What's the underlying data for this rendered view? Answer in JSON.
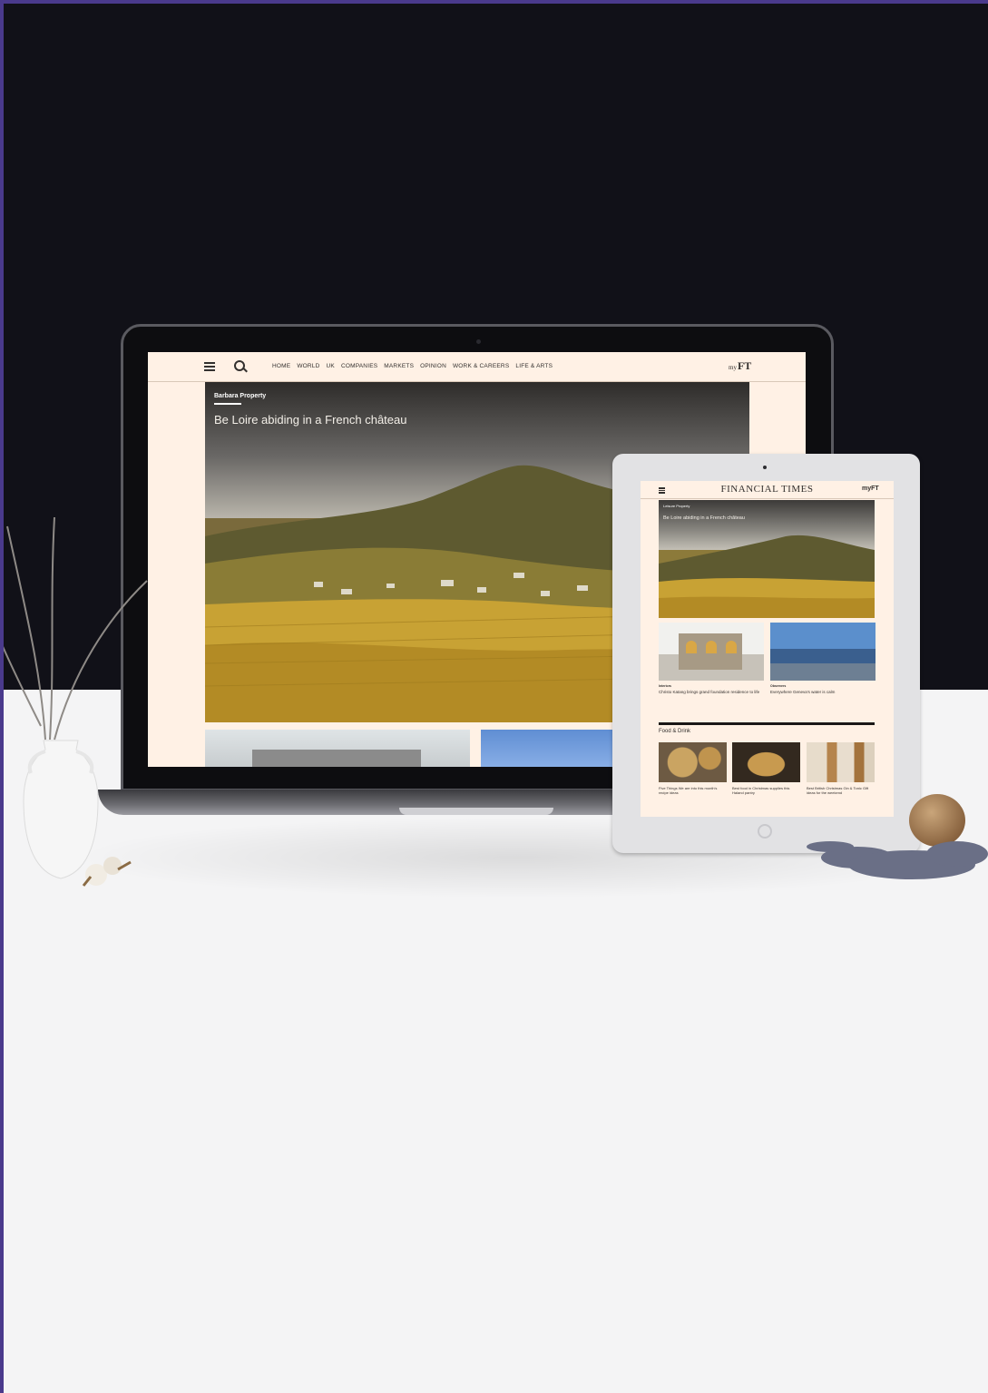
{
  "laptop": {
    "nav_items": [
      "HOME",
      "WORLD",
      "UK",
      "COMPANIES",
      "MARKETS",
      "OPINION",
      "WORK & CAREERS",
      "LIFE & ARTS"
    ],
    "logo_small": "my",
    "logo": "FT",
    "hero_tag": "Barbara Property",
    "hero_title": "Be Loire abiding in a French château"
  },
  "tablet": {
    "brand": "FINANCIAL TIMES",
    "logo": "myFT",
    "hero_tag": "Leisure Property",
    "hero_title": "Be Loire abiding in a French château",
    "articles": [
      {
        "tag": "Interiors",
        "text": "Christo Katang brings grand foundation residence to life"
      },
      {
        "tag": "Observers",
        "text": "Everywhere Geneva's water is calm"
      }
    ],
    "section_title": "Food & Drink",
    "food_captions": [
      "Five Things We are into this month's recipe ideas",
      "Best food in Christmas supplies this Haland pantry",
      "Best British Christmas Gin & Tonic Gift ideas for the weekend"
    ]
  },
  "colors": {
    "ft_paper": "#fff1e5",
    "backdrop_dark": "#111118",
    "floor": "#f4f4f5",
    "frame_accent": "#4a3a8c"
  }
}
